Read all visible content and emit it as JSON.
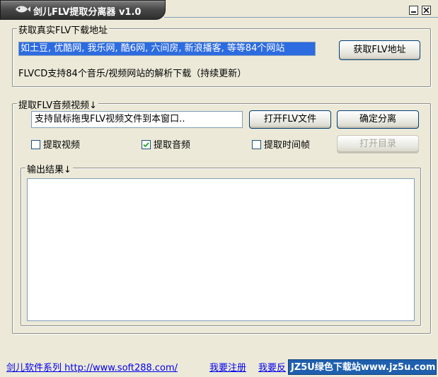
{
  "window": {
    "title": "剑儿FLV提取分离器 v1.0",
    "icons": {
      "app": "fish-icon",
      "minimize": "minimize-icon",
      "close": "close-icon"
    }
  },
  "fetch_group": {
    "legend": "获取真实FLV下载地址",
    "url_field_value": "如土豆, 优酷网, 我乐网, 酷6网, 六间房, 新浪播客, 等等84个网站",
    "get_url_button": "获取FLV地址",
    "info_text": "FLVCD支持84个音乐/视频网站的解析下载（持续更新）"
  },
  "extract_group": {
    "legend": "提取FLV音频视频↓",
    "drop_field_value": "支持鼠标拖曳FLV视频文件到本窗口..",
    "open_flv_button": "打开FLV文件",
    "split_button": "确定分离",
    "open_dir_button": "打开目录",
    "checkboxes": [
      {
        "label": "提取视频",
        "checked": false
      },
      {
        "label": "提取音频",
        "checked": true
      },
      {
        "label": "提取时间帧",
        "checked": false
      }
    ],
    "output_legend": "输出结果↓",
    "output_text": ""
  },
  "footer": {
    "site_link": "剑儿软件系列 http://www.soft288.com/",
    "register_link": "我要注册",
    "feedback_link": "我要反",
    "watermark": "JZ5U绿色下载站www.jz5u.com"
  },
  "colors": {
    "window_bg": "#ece9d8",
    "selection_bg": "#2d6be0",
    "button_border": "#003c74",
    "link": "#0000ee",
    "watermark_bg": "#1f5fae"
  }
}
